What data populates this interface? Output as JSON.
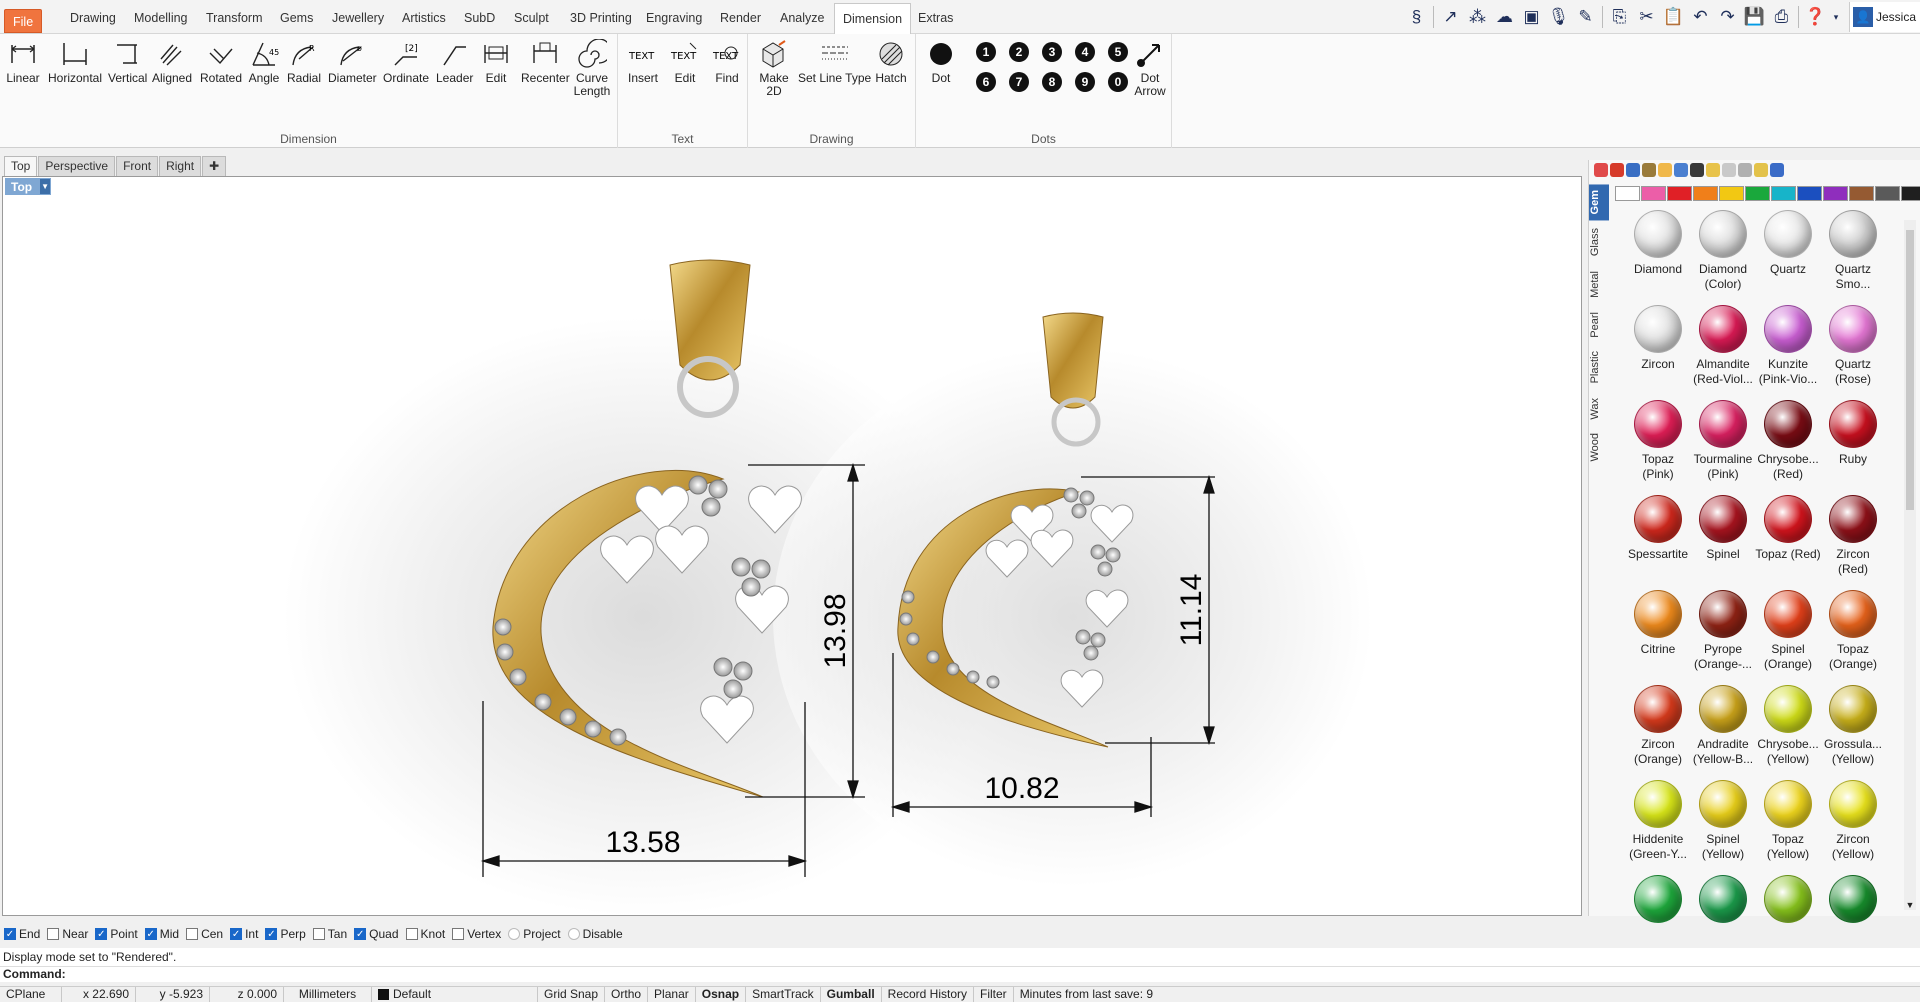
{
  "menu": {
    "tabs": [
      "File",
      "Drawing",
      "Modelling",
      "Transform",
      "Gems",
      "Jewellery",
      "Artistics",
      "SubD",
      "Sculpt",
      "3D Printing",
      "Engraving",
      "Render",
      "Analyze",
      "Dimension",
      "Extras"
    ],
    "active": "Dimension"
  },
  "user": {
    "name": "Jessica"
  },
  "ribbon": {
    "dimension": {
      "label": "Dimension",
      "buttons": [
        "Linear",
        "Horizontal",
        "Vertical",
        "Aligned",
        "Rotated",
        "Angle",
        "Radial",
        "Diameter",
        "Ordinate",
        "Leader",
        "Edit",
        "Recenter",
        "Curve Length"
      ]
    },
    "text": {
      "label": "Text",
      "buttons": [
        "Insert",
        "Edit",
        "Find"
      ]
    },
    "drawing": {
      "label": "Drawing",
      "buttons": [
        "Make 2D",
        "Set Line Type",
        "Hatch"
      ]
    },
    "dots": {
      "label": "Dots",
      "dot": "Dot",
      "dot_arrow": "Dot Arrow",
      "numbers": [
        "1",
        "2",
        "3",
        "4",
        "5",
        "6",
        "7",
        "8",
        "9",
        "0"
      ]
    }
  },
  "viewports": {
    "tabs": [
      "Top",
      "Perspective",
      "Front",
      "Right"
    ],
    "active_label": "Top"
  },
  "dimensions": {
    "left_width": "13.58",
    "left_height": "13.98",
    "right_width": "10.82",
    "right_height": "11.14"
  },
  "panel": {
    "vtabs": [
      "Gem",
      "Glass",
      "Metal",
      "Pearl",
      "Plastic",
      "Wax",
      "Wood"
    ],
    "swatches": [
      "#ffffff",
      "#ec5ea8",
      "#e02026",
      "#f07f1a",
      "#f2c813",
      "#1aa83c",
      "#17b4c9",
      "#1b4fbf",
      "#8f2ebd",
      "#955a32",
      "#5a5a5a",
      "#1f1f1f"
    ],
    "gems": [
      {
        "name": "Diamond",
        "color": "#e4e4e4"
      },
      {
        "name": "Diamond (Color)",
        "color": "#dedede"
      },
      {
        "name": "Quartz",
        "color": "#e8e8e8"
      },
      {
        "name": "Quartz Smo...",
        "color": "#cfcfcf"
      },
      {
        "name": "Zircon",
        "color": "#e2e2e2"
      },
      {
        "name": "Almandite (Red-Viol...",
        "color": "#d91a54"
      },
      {
        "name": "Kunzite (Pink-Vio...",
        "color": "#c95ed2"
      },
      {
        "name": "Quartz (Rose)",
        "color": "#e477d4"
      },
      {
        "name": "Topaz (Pink)",
        "color": "#e01e56"
      },
      {
        "name": "Tourmaline (Pink)",
        "color": "#d92060"
      },
      {
        "name": "Chrysobe... (Red)",
        "color": "#7a0c14"
      },
      {
        "name": "Ruby",
        "color": "#c8101f"
      },
      {
        "name": "Spessartite",
        "color": "#d0281d"
      },
      {
        "name": "Spinel",
        "color": "#a8141f"
      },
      {
        "name": "Topaz (Red)",
        "color": "#d2141d"
      },
      {
        "name": "Zircon (Red)",
        "color": "#8e1018"
      },
      {
        "name": "Citrine",
        "color": "#ee8a1c"
      },
      {
        "name": "Pyrope (Orange-...",
        "color": "#8f2214"
      },
      {
        "name": "Spinel (Orange)",
        "color": "#e2401a"
      },
      {
        "name": "Topaz (Orange)",
        "color": "#e6621b"
      },
      {
        "name": "Zircon (Orange)",
        "color": "#d63a1c"
      },
      {
        "name": "Andradite (Yellow-B...",
        "color": "#c9a21a"
      },
      {
        "name": "Chrysobe... (Yellow)",
        "color": "#cfdc18"
      },
      {
        "name": "Grossula... (Yellow)",
        "color": "#c8b01a"
      },
      {
        "name": "Hiddenite (Green-Y...",
        "color": "#d8e619"
      },
      {
        "name": "Spinel (Yellow)",
        "color": "#e8cf1a"
      },
      {
        "name": "Topaz (Yellow)",
        "color": "#eed51d"
      },
      {
        "name": "Zircon (Yellow)",
        "color": "#e8e21c"
      },
      {
        "name": "",
        "color": "#1ea83c"
      },
      {
        "name": "",
        "color": "#1b9a4a"
      },
      {
        "name": "",
        "color": "#86c21c"
      },
      {
        "name": "",
        "color": "#178c2c"
      }
    ]
  },
  "osnap": [
    {
      "label": "End",
      "on": true
    },
    {
      "label": "Near",
      "on": false
    },
    {
      "label": "Point",
      "on": true
    },
    {
      "label": "Mid",
      "on": true
    },
    {
      "label": "Cen",
      "on": false
    },
    {
      "label": "Int",
      "on": true
    },
    {
      "label": "Perp",
      "on": true
    },
    {
      "label": "Tan",
      "on": false
    },
    {
      "label": "Quad",
      "on": true
    },
    {
      "label": "Knot",
      "on": false
    },
    {
      "label": "Vertex",
      "on": false
    },
    {
      "label": "Project",
      "radio": true
    },
    {
      "label": "Disable",
      "radio": true
    }
  ],
  "command": {
    "history": "Display mode set to \"Rendered\".",
    "prompt": "Command:"
  },
  "status": {
    "cplane": "CPlane",
    "x": "x 22.690",
    "y": "y -5.923",
    "z": "z 0.000",
    "units": "Millimeters",
    "layer": "Default",
    "toggles": [
      "Grid Snap",
      "Ortho",
      "Planar",
      "Osnap",
      "SmartTrack",
      "Gumball",
      "Record History",
      "Filter"
    ],
    "bold": [
      "Osnap",
      "Gumball"
    ],
    "save": "Minutes from last save: 9"
  }
}
